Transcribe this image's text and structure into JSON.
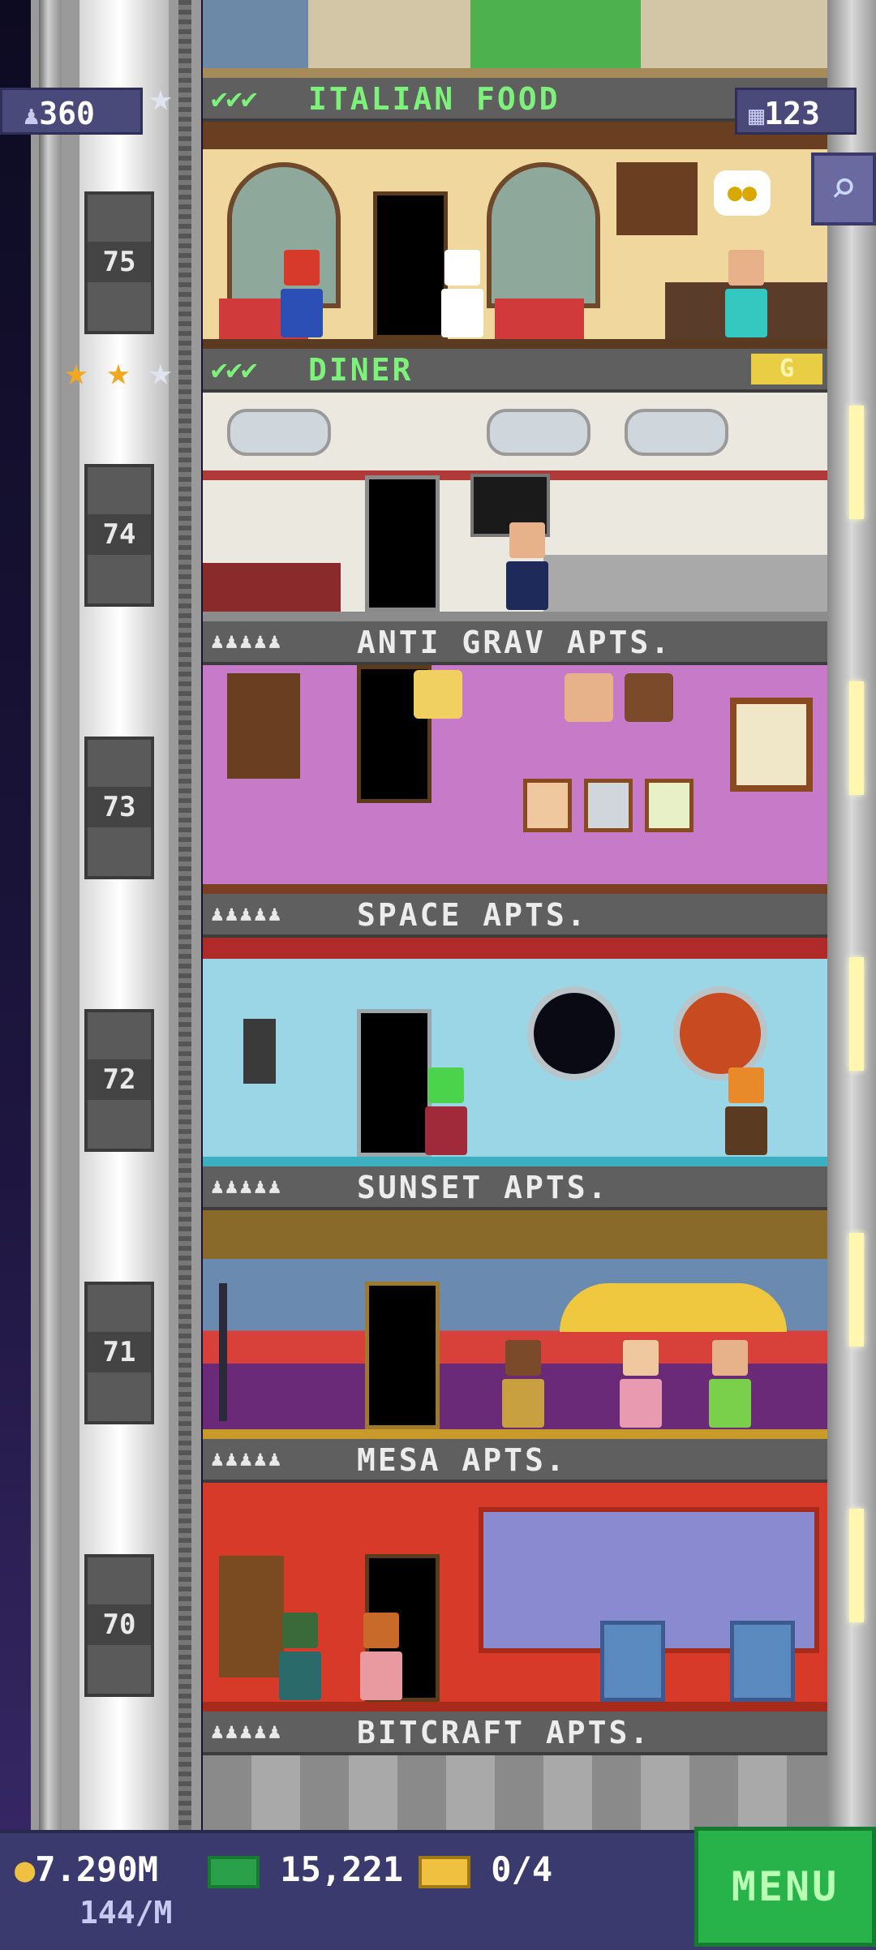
{
  "hud": {
    "population": "360",
    "floors": "123",
    "coins": "7.290M",
    "coin_rate": "144/M",
    "bux": "15,221",
    "tickets": "0/4",
    "menu_label": "MENU"
  },
  "floors": [
    {
      "number": "75",
      "name": "ITALIAN FOOD",
      "type": "business",
      "checks": "✔✔✔",
      "rating": [
        "silver"
      ]
    },
    {
      "number": "74",
      "name": "DINER",
      "type": "business",
      "checks": "✔✔✔",
      "rating": [
        "gold",
        "gold",
        "silver"
      ],
      "badge": "G"
    },
    {
      "number": "73",
      "name": "ANTI GRAV APTS.",
      "type": "residential",
      "occupancy": "♟♟♟♟♟"
    },
    {
      "number": "72",
      "name": "SPACE APTS.",
      "type": "residential",
      "occupancy": "♟♟♟♟♟"
    },
    {
      "number": "71",
      "name": "SUNSET APTS.",
      "type": "residential",
      "occupancy": "♟♟♟♟♟"
    },
    {
      "number": "70",
      "name": "MESA APTS.",
      "type": "residential",
      "occupancy": "♟♟♟♟♟"
    },
    {
      "number": "",
      "name": "BITCRAFT APTS.",
      "type": "residential",
      "occupancy": "♟♟♟♟♟"
    }
  ],
  "icons": {
    "population": "person-icon",
    "floors": "building-icon",
    "search": "magnifier-icon",
    "coin": "coin-icon",
    "bux": "cash-icon",
    "ticket": "ticket-icon"
  },
  "colors": {
    "business_label": "#7df27a",
    "hud_bg": "#3a3a6e",
    "menu_bg": "#27b34a"
  }
}
